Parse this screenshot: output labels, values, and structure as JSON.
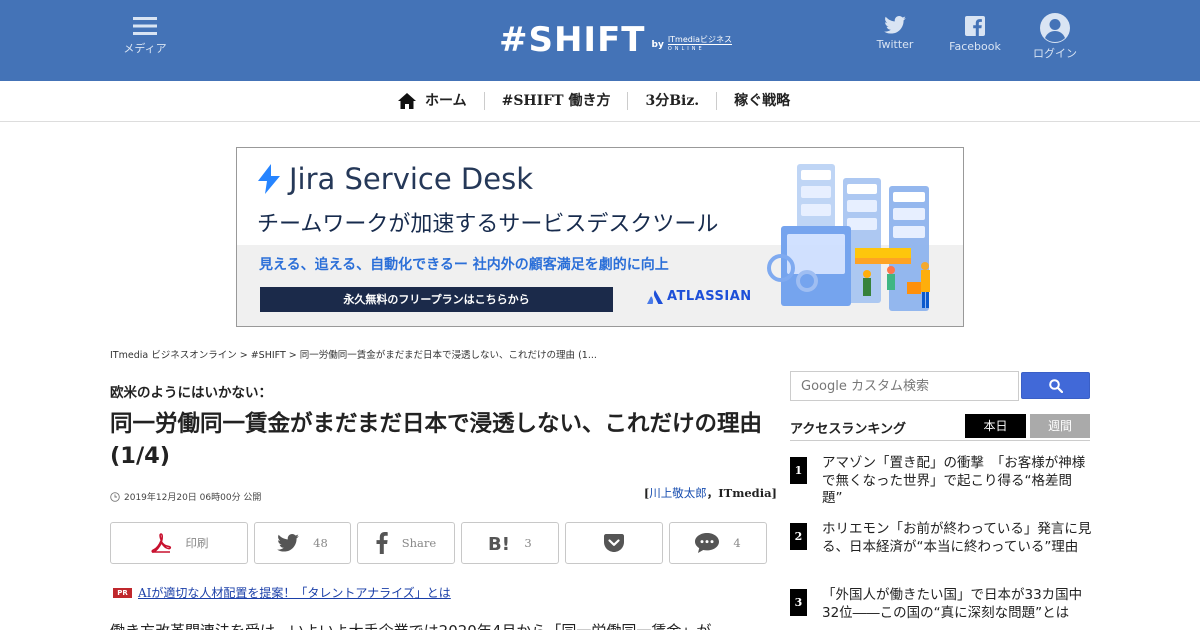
{
  "header": {
    "menu_label": "メディア",
    "logo_main": "#SHIFT",
    "logo_by": "by",
    "logo_brand": "ITmediaビジネス",
    "logo_brand_sub": "ONLINE",
    "twitter_label": "Twitter",
    "facebook_label": "Facebook",
    "login_label": "ログイン",
    "bg_color": "#4473b7"
  },
  "nav": {
    "items": [
      {
        "label": "ホーム"
      },
      {
        "label": "#SHIFT 働き方"
      },
      {
        "label": "3分Biz."
      },
      {
        "label": "稼ぐ戦略"
      }
    ]
  },
  "ad": {
    "logo_text": "Jira Service Desk",
    "headline": "チームワークが加速するサービスデスクツール",
    "subline": "見える、追える、自動化できるー 社内外の顧客満足を劇的に向上",
    "cta": "永久無料のフリープランはこちらから",
    "sponsor": "ATLASSIAN"
  },
  "breadcrumb": "ITmedia ビジネスオンライン > #SHIFT > 同一労働同一賃金がまだまだ日本で浸透しない、これだけの理由 (1...",
  "article": {
    "kicker": "欧米のようにはいかない：",
    "title": "同一労働同一賃金がまだまだ日本で浸透しない、これだけの理由 (1/4)",
    "date": "2019年12月20日 06時00分 公開",
    "author_prefix": "[",
    "author_name": "川上敬太郎",
    "author_suffix": "，ITmedia]",
    "share": {
      "print": "印刷",
      "twitter_count": "48",
      "facebook": "Share",
      "hatena_count": "3",
      "comments_count": "4"
    },
    "pr_badge": "PR",
    "pr_link": "AIが適切な人材配置を提案！「タレントアナライズ」とは",
    "body_start": "働き方改革関連法を受け、いよいよ大手企業では2020年4月から「同一労働同一賃金」が"
  },
  "sidebar": {
    "search_placeholder": "Google カスタム検索",
    "ranking_title": "アクセスランキング",
    "tab_today": "本日",
    "tab_week": "週間",
    "ranking": [
      {
        "rank": "1",
        "text": "アマゾン「置き配」の衝撃　「お客様が神様で無くなった世界」で起こり得る“格差問題”"
      },
      {
        "rank": "2",
        "text": "ホリエモン「お前が終わっている」発言に見る、日本経済が“本当に終わっている”理由"
      },
      {
        "rank": "3",
        "text": "「外国人が働きたい国」で日本が33カ国中32位――この国の“真に深刻な問題”とは"
      }
    ]
  }
}
